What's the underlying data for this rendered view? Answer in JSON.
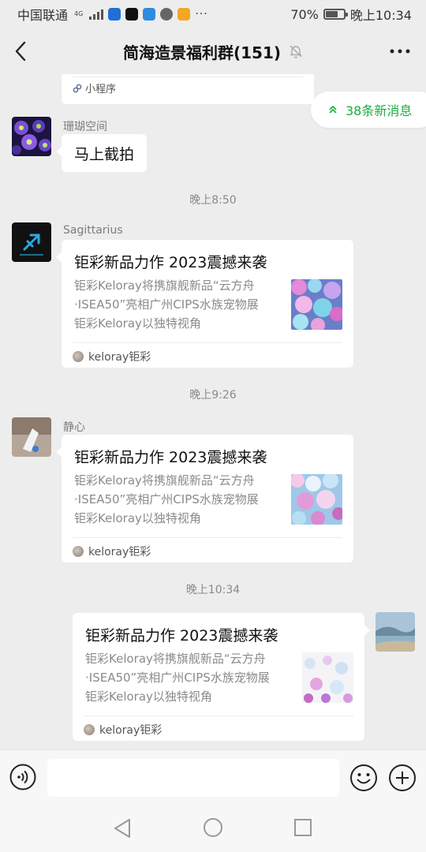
{
  "status_bar": {
    "carrier": "中国联通",
    "network": "4G",
    "battery_percent": "70%",
    "battery_level": 0.7,
    "time": "晚上10:34",
    "more_indicator": "···"
  },
  "header": {
    "title": "简海造景福利群(151)",
    "back_icon": "chevron-left-icon",
    "mute_icon": "bell-muted-icon",
    "more_icon": "more-dots-icon"
  },
  "new_messages": {
    "label": "38条新消息",
    "icon": "double-chevron-up-icon",
    "accent": "#1aad3f"
  },
  "messages": [
    {
      "type": "mini_program",
      "label": "小程序"
    },
    {
      "type": "text",
      "sender": "珊瑚空间",
      "text": "马上截拍"
    },
    {
      "type": "time",
      "text": "晚上8:50"
    },
    {
      "type": "link",
      "sender": "Sagittarius",
      "title": "钜彩新品力作 2023震撼来袭",
      "desc": [
        "钜彩Keloray将携旗舰新品“云方舟",
        "·ISEA50”亮相广州CIPS水族宠物展",
        "钜彩Keloray以独特视角"
      ],
      "source": "keloray钜彩"
    },
    {
      "type": "time",
      "text": "晚上9:26"
    },
    {
      "type": "link",
      "sender": "静心",
      "title": "钜彩新品力作 2023震撼来袭",
      "desc": [
        "钜彩Keloray将携旗舰新品“云方舟",
        "·ISEA50”亮相广州CIPS水族宠物展",
        "钜彩Keloray以独特视角"
      ],
      "source": "keloray钜彩"
    },
    {
      "type": "time",
      "text": "晚上10:34"
    },
    {
      "type": "link",
      "sender": "",
      "title": "钜彩新品力作 2023震撼来袭",
      "desc": [
        "钜彩Keloray将携旗舰新品“云方舟",
        "·ISEA50”亮相广州CIPS水族宠物展",
        "钜彩Keloray以独特视角"
      ],
      "source": "keloray钜彩",
      "self": true
    }
  ],
  "input_bar": {
    "placeholder": "",
    "voice_icon": "voice-icon",
    "emoji_icon": "emoji-icon",
    "plus_icon": "plus-icon"
  },
  "nav_bar": {
    "back_icon": "triangle-back-icon",
    "home_icon": "circle-home-icon",
    "recent_icon": "square-recent-icon"
  },
  "colors": {
    "background": "#ededed",
    "bubble": "#ffffff",
    "accent_green": "#1aad3f"
  }
}
